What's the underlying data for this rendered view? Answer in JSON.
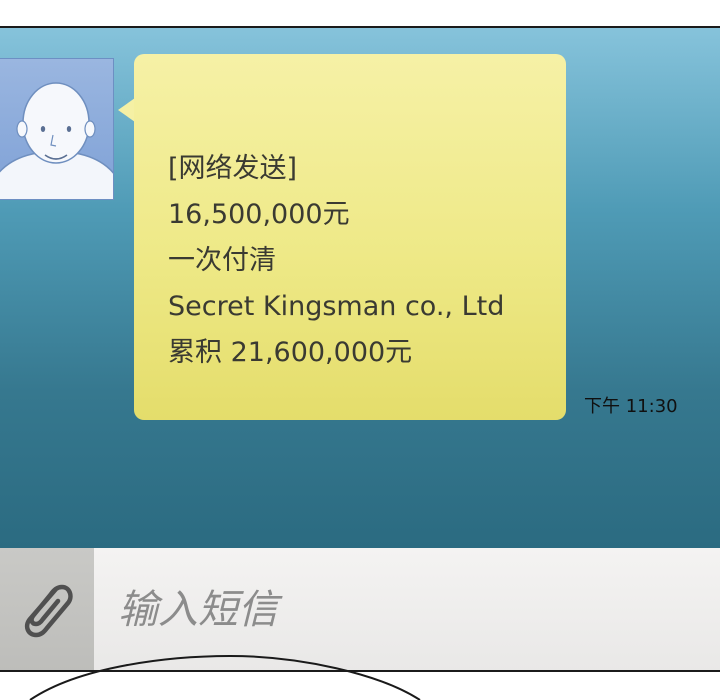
{
  "message": {
    "lines": [
      "[网络发送]",
      "16,500,000元",
      "一次付清",
      "Secret Kingsman co., Ltd",
      "累积 21,600,000元"
    ],
    "timestamp": "下午 11:30"
  },
  "composer": {
    "placeholder": "输入短信",
    "value": "",
    "attach_icon": "paperclip-icon"
  },
  "colors": {
    "chat_bg_top": "#86c3db",
    "chat_bg_bottom": "#2b6b81",
    "bubble": "#eee987",
    "avatar_bg": "#8aa9da",
    "input_bg": "#efedec",
    "attach_bg": "#c4c4c1"
  }
}
